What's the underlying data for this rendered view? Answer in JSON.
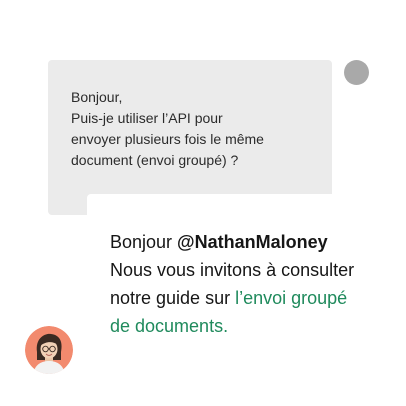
{
  "question": {
    "lines": [
      "Bonjour,",
      "Puis-je utiliser l’API pour",
      "envoyer plusieurs fois le même",
      "document (envoi groupé) ?"
    ]
  },
  "answer": {
    "greeting": "Bonjour ",
    "mention": "@NathanMaloney",
    "line2": "Nous vous invitons à consulter",
    "line3_text": "notre guide sur ",
    "link_part1": "l’envoi groupé",
    "link_part2": "de documents."
  },
  "colors": {
    "question_bubble": "#ebebeb",
    "user_avatar": "#a9a9a9",
    "link": "#1f8a5c",
    "agent_avatar_bg": "#f28a6e"
  },
  "icons": {
    "user_avatar": "user-avatar-placeholder",
    "agent_avatar": "agent-avatar-illustration"
  }
}
